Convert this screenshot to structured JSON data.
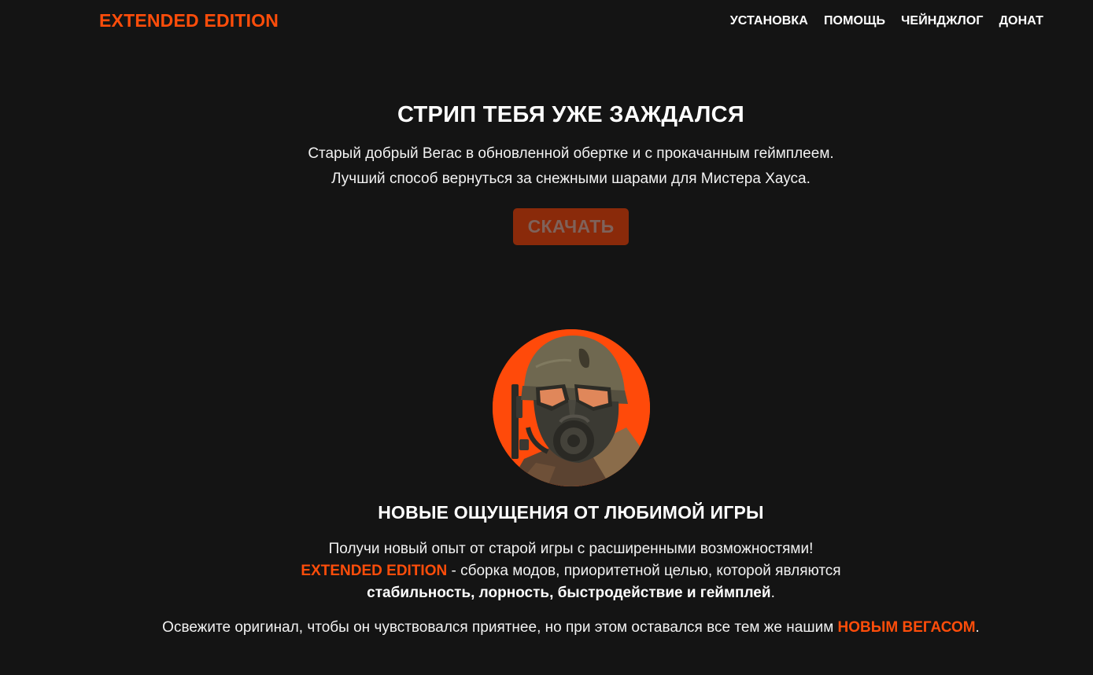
{
  "header": {
    "logo": "EXTENDED EDITION",
    "nav": [
      "УСТАНОВКА",
      "ПОМОЩЬ",
      "ЧЕЙНДЖЛОГ",
      "ДОНАТ"
    ]
  },
  "hero": {
    "title": "СТРИП ТЕБЯ УЖЕ ЗАЖДАЛСЯ",
    "subtitle_line1": "Старый добрый Вегас в обновленной обертке и с прокачанным геймплеем.",
    "subtitle_line2": "Лучший способ вернуться за снежными шарами для Мистера Хауса.",
    "download_label": "СКАЧАТЬ"
  },
  "feature": {
    "title": "НОВЫЕ ОЩУЩЕНИЯ ОТ ЛЮБИМОЙ ИГРЫ",
    "line1": "Получи новый опыт от старой игры с расширенными возможностями!",
    "line2_accent": "EXTENDED EDITION",
    "line2_rest": " - сборка модов, приоритетной целью, которой являются",
    "line3_bold": "стабильность, лорность, быстродействие и геймплей",
    "line3_end": ".",
    "line4_text": "Освежите оригинал, чтобы он чувствовался приятнее, но при этом оставался все тем же нашим ",
    "line4_accent": "НОВЫМ ВЕГАСОМ",
    "line4_end": "."
  },
  "colors": {
    "background": "#141414",
    "accent": "#ff4d0a",
    "button": "#8a2a0a"
  },
  "icons": {
    "avatar": "ncr-ranger-helmet-illustration"
  }
}
